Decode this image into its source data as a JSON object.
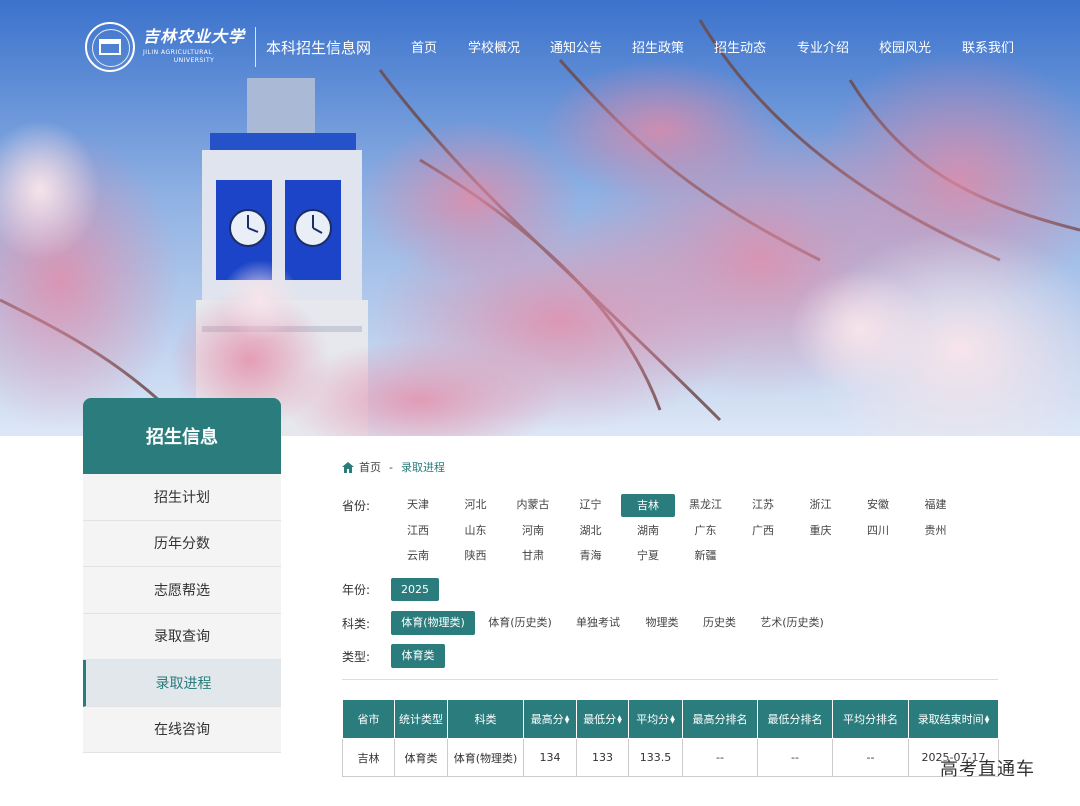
{
  "header": {
    "logo_cn": "吉林农业大学",
    "logo_en_1": "JILIN AGRICULTURAL",
    "logo_en_2": "UNIVERSITY",
    "site_name": "本科招生信息网"
  },
  "nav": [
    "首页",
    "学校概况",
    "通知公告",
    "招生政策",
    "招生动态",
    "专业介绍",
    "校园风光",
    "联系我们"
  ],
  "sidebar": {
    "title": "招生信息",
    "items": [
      "招生计划",
      "历年分数",
      "志愿帮选",
      "录取查询",
      "录取进程",
      "在线咨询"
    ],
    "active": "录取进程"
  },
  "breadcrumb": {
    "home": "首页",
    "sep": "-",
    "current": "录取进程"
  },
  "filters": {
    "province_label": "省份:",
    "provinces": [
      "天津",
      "河北",
      "内蒙古",
      "辽宁",
      "吉林",
      "黑龙江",
      "江苏",
      "浙江",
      "安徽",
      "福建",
      "江西",
      "山东",
      "河南",
      "湖北",
      "湖南",
      "广东",
      "广西",
      "重庆",
      "四川",
      "贵州",
      "云南",
      "陕西",
      "甘肃",
      "青海",
      "宁夏",
      "新疆"
    ],
    "province_selected": "吉林",
    "year_label": "年份:",
    "years": [
      "2025"
    ],
    "year_selected": "2025",
    "subject_label": "科类:",
    "subjects": [
      "体育(物理类)",
      "体育(历史类)",
      "单独考试",
      "物理类",
      "历史类",
      "艺术(历史类)"
    ],
    "subject_selected": "体育(物理类)",
    "type_label": "类型:",
    "types": [
      "体育类"
    ],
    "type_selected": "体育类"
  },
  "table": {
    "columns": [
      "省市",
      "统计类型",
      "科类",
      "最高分",
      "最低分",
      "平均分",
      "最高分排名",
      "最低分排名",
      "平均分排名",
      "录取结束时间"
    ],
    "sortable": [
      false,
      false,
      false,
      true,
      true,
      true,
      false,
      false,
      false,
      true
    ],
    "rows": [
      [
        "吉林",
        "体育类",
        "体育(物理类)",
        "134",
        "133",
        "133.5",
        "--",
        "--",
        "--",
        "2025-07-17"
      ]
    ]
  },
  "watermark": "高考直通车",
  "colors": {
    "accent": "#2b7c7d",
    "nav_text": "#ffffff",
    "sidebar_bg": "#f4f4f4",
    "sidebar_active_bg": "#e1e7ea"
  }
}
